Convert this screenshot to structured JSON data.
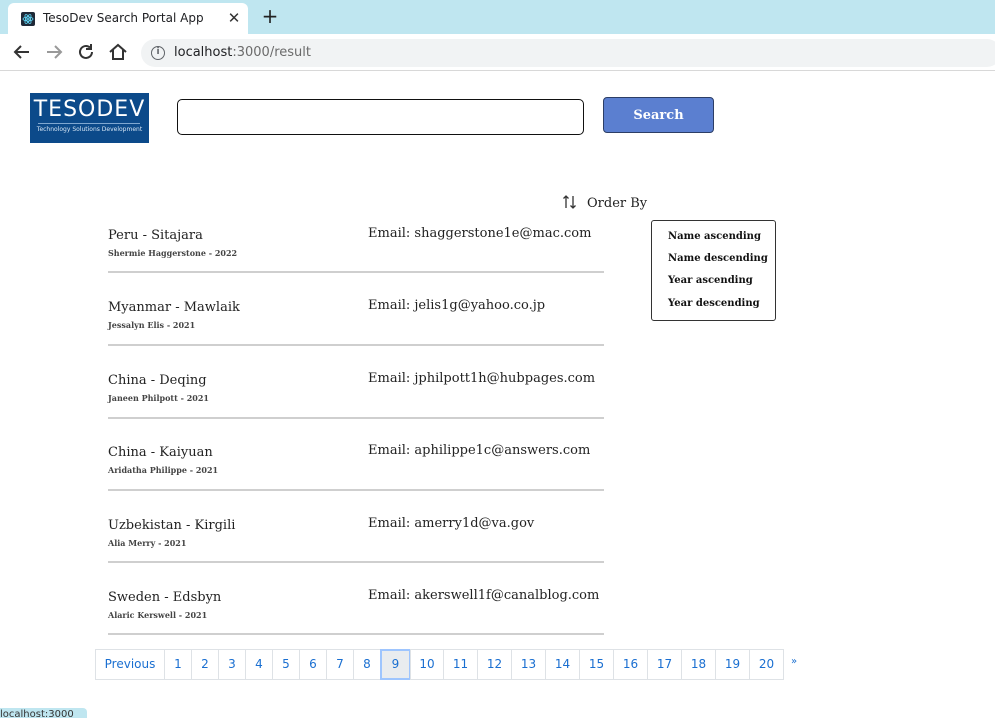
{
  "browser": {
    "tab_title": "TesoDev Search Portal App",
    "url_host": "localhost",
    "url_path": ":3000/result",
    "status_text": "localhost:3000"
  },
  "header": {
    "logo_text": "TESODEV",
    "logo_subtext": "Technology Solutions Development",
    "search_value": "",
    "search_label": "Search"
  },
  "order": {
    "label": "Order By",
    "options": [
      "Name ascending",
      "Name descending",
      "Year ascending",
      "Year descending"
    ]
  },
  "results": [
    {
      "title": "Peru - Sitajara",
      "subtitle": "Shermie Haggerstone - 2022",
      "email": "Email: shaggerstone1e@mac.com"
    },
    {
      "title": "Myanmar - Mawlaik",
      "subtitle": "Jessalyn Elis - 2021",
      "email": "Email: jelis1g@yahoo.co.jp"
    },
    {
      "title": "China - Deqing",
      "subtitle": "Janeen Philpott - 2021",
      "email": "Email: jphilpott1h@hubpages.com"
    },
    {
      "title": "China - Kaiyuan",
      "subtitle": "Aridatha Philippe - 2021",
      "email": "Email: aphilippe1c@answers.com"
    },
    {
      "title": "Uzbekistan - Kirgili",
      "subtitle": "Alia Merry - 2021",
      "email": "Email: amerry1d@va.gov"
    },
    {
      "title": "Sweden - Edsbyn",
      "subtitle": "Alaric Kerswell - 2021",
      "email": "Email: akerswell1f@canalblog.com"
    }
  ],
  "pagination": {
    "previous_label": "Previous",
    "pages": [
      "1",
      "2",
      "3",
      "4",
      "5",
      "6",
      "7",
      "8",
      "9",
      "10",
      "11",
      "12",
      "13",
      "14",
      "15",
      "16",
      "17",
      "18",
      "19",
      "20"
    ],
    "active_page": "9",
    "next_label": "»"
  }
}
